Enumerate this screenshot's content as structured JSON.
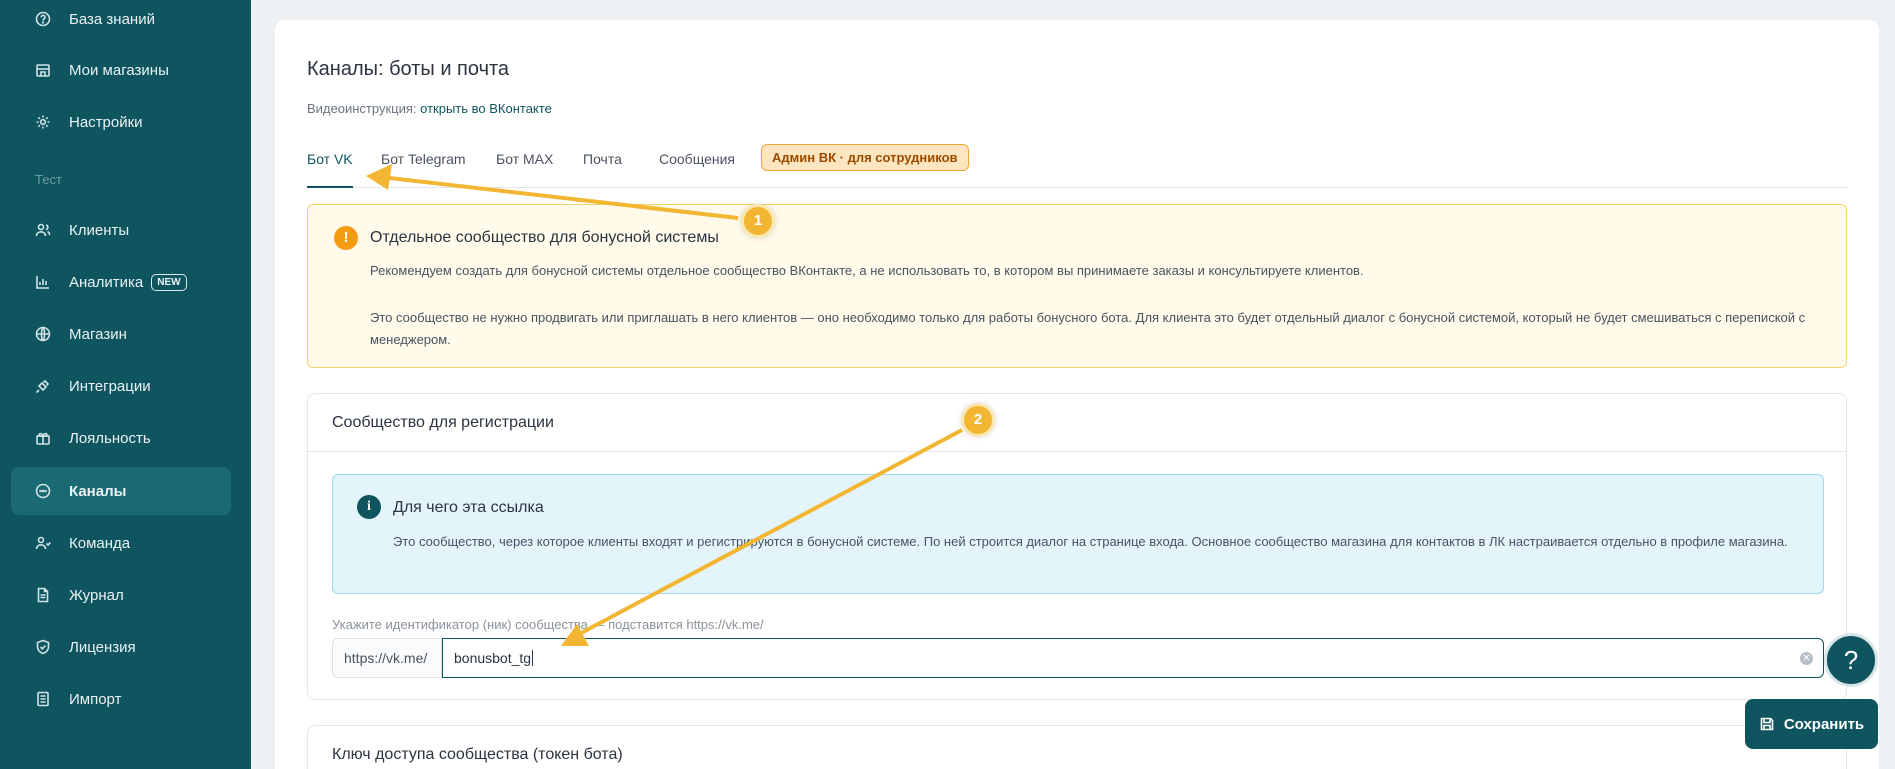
{
  "sidebar": {
    "items": [
      {
        "label": "База знаний",
        "icon": "help-circle-icon"
      },
      {
        "label": "Мои магазины",
        "icon": "store-icon"
      },
      {
        "label": "Настройки",
        "icon": "gear-icon"
      },
      {
        "label": "Тест"
      },
      {
        "label": "Клиенты",
        "icon": "users-icon"
      },
      {
        "label": "Аналитика",
        "icon": "bar-chart-icon",
        "badge": "NEW"
      },
      {
        "label": "Магазин",
        "icon": "globe-icon"
      },
      {
        "label": "Интеграции",
        "icon": "plug-icon"
      },
      {
        "label": "Лояльность",
        "icon": "gift-icon"
      },
      {
        "label": "Каналы",
        "icon": "chat-icon"
      },
      {
        "label": "Команда",
        "icon": "team-icon"
      },
      {
        "label": "Журнал",
        "icon": "document-icon"
      },
      {
        "label": "Лицензия",
        "icon": "shield-icon"
      },
      {
        "label": "Импорт",
        "icon": "import-icon"
      }
    ]
  },
  "page": {
    "title": "Каналы: боты и почта",
    "video_prefix": "Видеоинструкция:",
    "video_link": "открыть во ВКонтакте"
  },
  "tabs": [
    {
      "label": "Бот VK",
      "active": true
    },
    {
      "label": "Бот Telegram"
    },
    {
      "label": "Бот MAX"
    },
    {
      "label": "Почта"
    },
    {
      "label": "Сообщения"
    },
    {
      "label": "Админ ВК · для сотрудников"
    }
  ],
  "warning": {
    "title": "Отдельное сообщество для бонусной системы",
    "p1": "Рекомендуем создать для бонусной системы отдельное сообщество ВКонтакте, а не использовать то, в котором вы принимаете заказы и консультируете клиентов.",
    "p2": "Это сообщество не нужно продвигать или приглашать в него клиентов — оно необходимо только для работы бонусного бота. Для клиента это будет отдельный диалог с бонусной системой, который не будет смешиваться с перепиской с менеджером."
  },
  "registration": {
    "title": "Сообщество для регистрации",
    "info_title": "Для чего эта ссылка",
    "info_text": "Это сообщество, через которое клиенты входят и регистрируются в бонусной системе. По ней строится диалог на странице входа. Основное сообщество магазина для контактов в ЛК настраивается отдельно в профиле магазина.",
    "field_label": "Укажите идентификатор (ник) сообщества — подставится https://vk.me/",
    "prefix": "https://vk.me/",
    "value": "bonusbot_tg"
  },
  "token_section": {
    "title": "Ключ доступа сообщества (токен бота)"
  },
  "buttons": {
    "help": "?",
    "save": "Сохранить"
  },
  "annotations": {
    "marker1": "1",
    "marker2": "2",
    "color": "#f2b632"
  },
  "colors": {
    "primary": "#0f5560",
    "warning_bg": "#fffaea",
    "info_bg": "#e3f4fb"
  }
}
